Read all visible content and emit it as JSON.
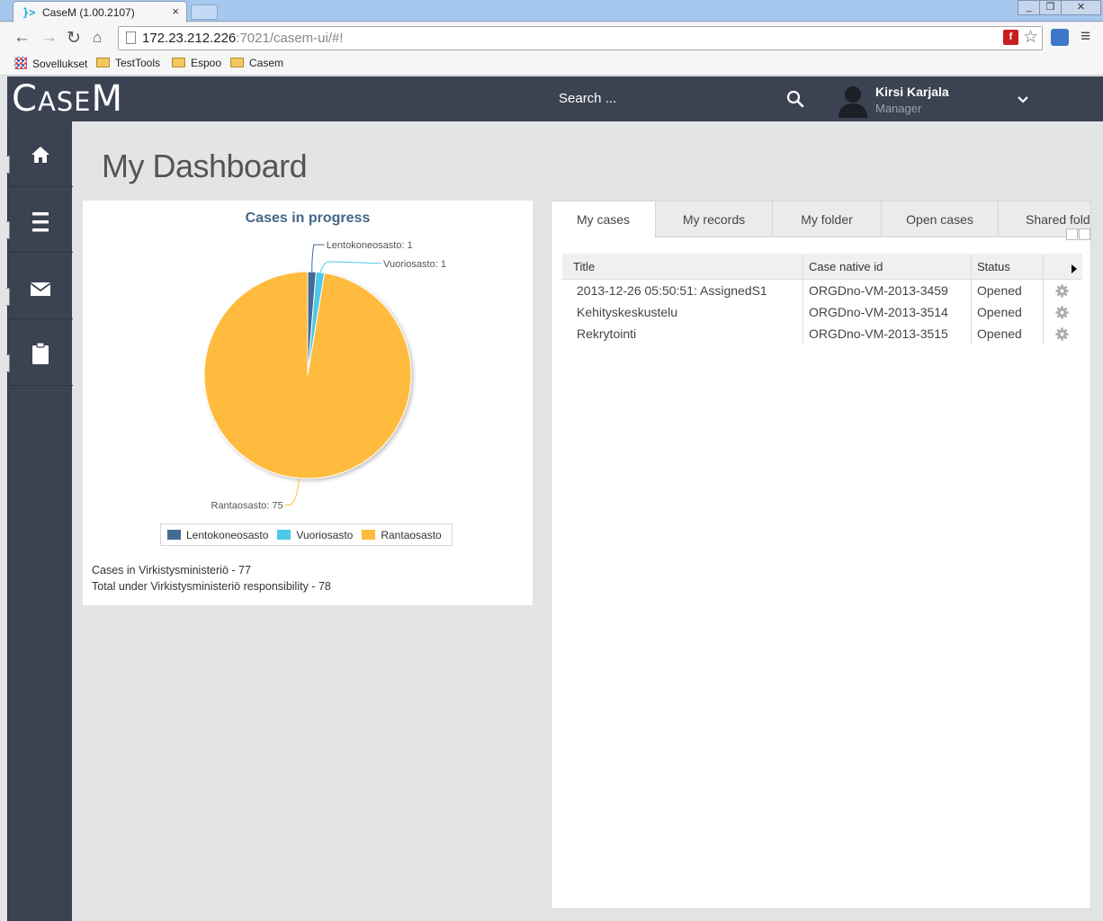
{
  "browser": {
    "tab_title": "CaseM (1.00.2107)",
    "tab_close": "×",
    "url_host": "172.23.212.226",
    "url_rest": ":7021/casem-ui/#!",
    "window_buttons": [
      "_",
      "❐",
      "✕"
    ],
    "bookmarks": [
      "Sovellukset",
      "TestTools",
      "Espoo",
      "Casem"
    ]
  },
  "header": {
    "logo_c": "C",
    "logo_ase": "ASE",
    "logo_m": "M",
    "search_label": "Search ...",
    "user_name": "Kirsi Karjala",
    "user_role": "Manager"
  },
  "sidebar": {
    "items": [
      {
        "icon": "home-icon"
      },
      {
        "icon": "list-icon"
      },
      {
        "icon": "mail-icon"
      },
      {
        "icon": "clipboard-icon"
      }
    ]
  },
  "page": {
    "title": "My Dashboard"
  },
  "chart_data": {
    "type": "pie",
    "title": "Cases in progress",
    "categories": [
      "Lentokoneosasto",
      "Vuoriosasto",
      "Rantaosasto"
    ],
    "values": [
      1,
      1,
      75
    ],
    "colors": [
      "#446b94",
      "#4dc8e8",
      "#ffbb3d"
    ],
    "data_labels": [
      "Lentokoneosasto: 1",
      "Vuoriosasto: 1",
      "Rantaosasto: 75"
    ],
    "legend": "bottom"
  },
  "stats": {
    "line1": "Cases in Virkistysministeriö - 77",
    "line2": "Total under Virkistysministeriö responsibility - 78"
  },
  "cases": {
    "tabs": [
      "My cases",
      "My records",
      "My folder",
      "Open cases",
      "Shared fold"
    ],
    "active_tab": "My cases",
    "columns": [
      "Title",
      "Case native id",
      "Status"
    ],
    "rows": [
      {
        "title": "2013-12-26 05:50:51: AssignedS1",
        "native_id": "ORGDno-VM-2013-3459",
        "status": "Opened"
      },
      {
        "title": "Kehityskeskustelu",
        "native_id": "ORGDno-VM-2013-3514",
        "status": "Opened"
      },
      {
        "title": "Rekrytointi",
        "native_id": "ORGDno-VM-2013-3515",
        "status": "Opened"
      }
    ]
  }
}
